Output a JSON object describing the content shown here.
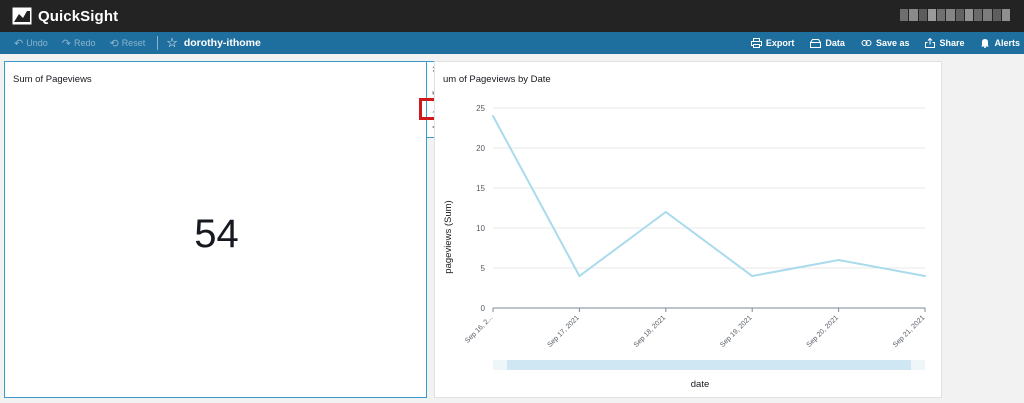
{
  "app": {
    "title": "QuickSight"
  },
  "toolbar": {
    "undo": "Undo",
    "redo": "Redo",
    "reset": "Reset",
    "sheet_name": "dorothy-ithome",
    "export": "Export",
    "data": "Data",
    "save_as": "Save as",
    "share": "Share",
    "alerts": "Alerts"
  },
  "kpi": {
    "title": "Sum of Pageviews",
    "value": "54"
  },
  "line_visual": {
    "title": "um of Pageviews by Date"
  },
  "visual_menu": {
    "icons": [
      "chevron-double-down-icon",
      "expand-icon",
      "alert-bell-icon",
      "more-options-icon"
    ]
  },
  "colors": {
    "topbar": "#232323",
    "toolbar": "#1f6f9e",
    "line": "#a9dbed",
    "selection": "#3b9bc8",
    "highlight_box": "#d11919"
  },
  "chart_data": {
    "type": "line",
    "x": [
      "Sep 16, 2...",
      "Sep 17, 2021",
      "Sep 18, 2021",
      "Sep 19, 2021",
      "Sep 20, 2021",
      "Sep 21, 2021"
    ],
    "series": [
      {
        "values": [
          24,
          4,
          12,
          4,
          6,
          4
        ]
      }
    ],
    "y_ticks": [
      0,
      5,
      10,
      15,
      20,
      25
    ],
    "ylim": [
      0,
      25
    ],
    "xlabel": "date",
    "ylabel": "pageviews (Sum)",
    "grid": true
  }
}
